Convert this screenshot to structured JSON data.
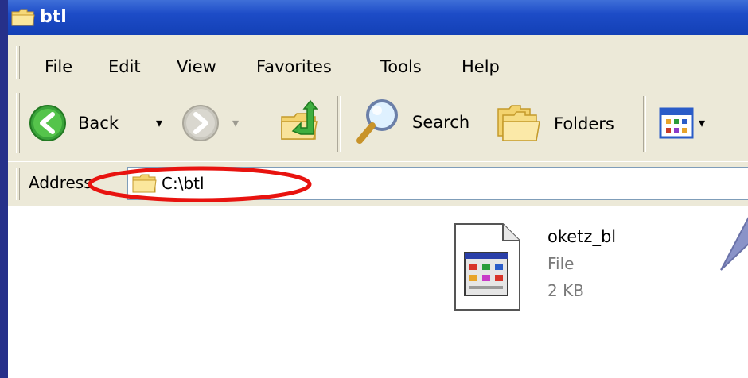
{
  "window": {
    "title": "btl"
  },
  "menu": [
    "File",
    "Edit",
    "View",
    "Favorites",
    "Tools",
    "Help"
  ],
  "toolbar": {
    "back_label": "Back",
    "search_label": "Search",
    "folders_label": "Folders"
  },
  "address": {
    "label": "Address",
    "path": "C:\\btl"
  },
  "file": {
    "name": "oketz_bl",
    "type": "File",
    "size": "2 KB"
  },
  "colors": {
    "titlebar": "#1d4cc7",
    "chrome": "#ece9d8",
    "highlight_oval": "#e8130f",
    "background": "#1e2775"
  }
}
